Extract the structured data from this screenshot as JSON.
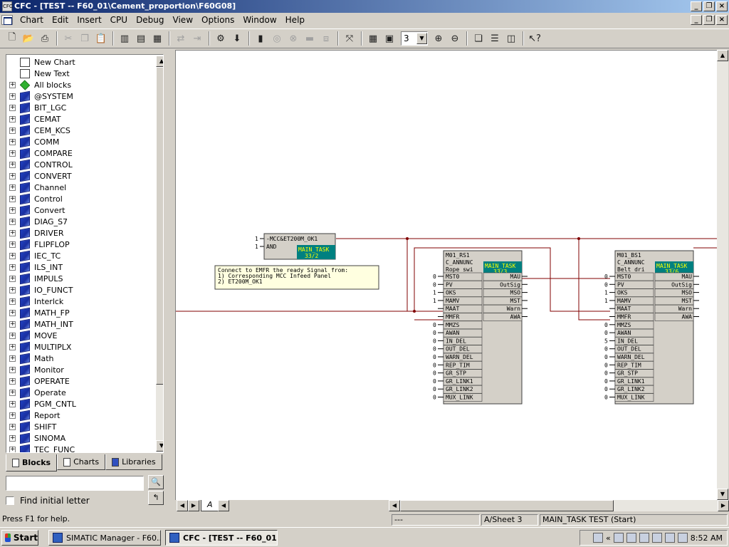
{
  "window": {
    "title": "CFC - [TEST -- F60_01\\Cement_proportion\\F60G08]",
    "app_icon": "cfc-app-icon"
  },
  "menu": [
    "Chart",
    "Edit",
    "Insert",
    "CPU",
    "Debug",
    "View",
    "Options",
    "Window",
    "Help"
  ],
  "toolbar": {
    "zoom_value": "3"
  },
  "tree": {
    "items": [
      {
        "label": "New Chart",
        "expandable": false,
        "icon": "new-chart-icon",
        "kind": "page"
      },
      {
        "label": "New Text",
        "expandable": false,
        "icon": "new-text-icon",
        "kind": "page"
      },
      {
        "label": "All blocks",
        "expandable": true,
        "icon": "all-blocks-icon",
        "kind": "gem"
      },
      {
        "label": "@SYSTEM",
        "expandable": true,
        "icon": "library-book-icon",
        "kind": "book"
      },
      {
        "label": "BIT_LGC",
        "expandable": true,
        "icon": "library-book-icon",
        "kind": "book"
      },
      {
        "label": "CEMAT",
        "expandable": true,
        "icon": "library-book-icon",
        "kind": "book"
      },
      {
        "label": "CEM_KCS",
        "expandable": true,
        "icon": "library-book-icon",
        "kind": "book"
      },
      {
        "label": "COMM",
        "expandable": true,
        "icon": "library-book-icon",
        "kind": "book"
      },
      {
        "label": "COMPARE",
        "expandable": true,
        "icon": "library-book-icon",
        "kind": "book"
      },
      {
        "label": "CONTROL",
        "expandable": true,
        "icon": "library-book-icon",
        "kind": "book"
      },
      {
        "label": "CONVERT",
        "expandable": true,
        "icon": "library-book-icon",
        "kind": "book"
      },
      {
        "label": "Channel",
        "expandable": true,
        "icon": "library-book-icon",
        "kind": "book"
      },
      {
        "label": "Control",
        "expandable": true,
        "icon": "library-book-icon",
        "kind": "book"
      },
      {
        "label": "Convert",
        "expandable": true,
        "icon": "library-book-icon",
        "kind": "book"
      },
      {
        "label": "DIAG_S7",
        "expandable": true,
        "icon": "library-book-icon",
        "kind": "book"
      },
      {
        "label": "DRIVER",
        "expandable": true,
        "icon": "library-book-icon",
        "kind": "book"
      },
      {
        "label": "FLIPFLOP",
        "expandable": true,
        "icon": "library-book-icon",
        "kind": "book"
      },
      {
        "label": "IEC_TC",
        "expandable": true,
        "icon": "library-book-icon",
        "kind": "book"
      },
      {
        "label": "ILS_INT",
        "expandable": true,
        "icon": "library-book-icon",
        "kind": "book"
      },
      {
        "label": "IMPULS",
        "expandable": true,
        "icon": "library-book-icon",
        "kind": "book"
      },
      {
        "label": "IO_FUNCT",
        "expandable": true,
        "icon": "library-book-icon",
        "kind": "book"
      },
      {
        "label": "Interlck",
        "expandable": true,
        "icon": "library-book-icon",
        "kind": "book"
      },
      {
        "label": "MATH_FP",
        "expandable": true,
        "icon": "library-book-icon",
        "kind": "book"
      },
      {
        "label": "MATH_INT",
        "expandable": true,
        "icon": "library-book-icon",
        "kind": "book"
      },
      {
        "label": "MOVE",
        "expandable": true,
        "icon": "library-book-icon",
        "kind": "book"
      },
      {
        "label": "MULTIPLX",
        "expandable": true,
        "icon": "library-book-icon",
        "kind": "book"
      },
      {
        "label": "Math",
        "expandable": true,
        "icon": "library-book-icon",
        "kind": "book"
      },
      {
        "label": "Monitor",
        "expandable": true,
        "icon": "library-book-icon",
        "kind": "book"
      },
      {
        "label": "OPERATE",
        "expandable": true,
        "icon": "library-book-icon",
        "kind": "book"
      },
      {
        "label": "Operate",
        "expandable": true,
        "icon": "library-book-icon",
        "kind": "book"
      },
      {
        "label": "PGM_CNTL",
        "expandable": true,
        "icon": "library-book-icon",
        "kind": "book"
      },
      {
        "label": "Report",
        "expandable": true,
        "icon": "library-book-icon",
        "kind": "book"
      },
      {
        "label": "SHIFT",
        "expandable": true,
        "icon": "library-book-icon",
        "kind": "book"
      },
      {
        "label": "SINOMA",
        "expandable": true,
        "icon": "library-book-icon",
        "kind": "book"
      },
      {
        "label": "TEC_FUNC",
        "expandable": true,
        "icon": "library-book-icon",
        "kind": "book"
      }
    ]
  },
  "panel_tabs": [
    {
      "label": "Blocks",
      "icon": "blocks-tab-icon",
      "active": true
    },
    {
      "label": "Charts",
      "icon": "charts-tab-icon",
      "active": false
    },
    {
      "label": "Libraries",
      "icon": "libraries-tab-icon",
      "active": false
    }
  ],
  "find": {
    "value": "",
    "checkbox_label": "Find initial letter"
  },
  "canvas": {
    "and_block": {
      "name": "-MCC&ET200M_OK1",
      "type": "AND",
      "task": "MAIN_TASK",
      "task_seq": "33/2",
      "inputs": [
        {
          "name": "",
          "val": "1"
        },
        {
          "name": "",
          "val": "1"
        }
      ]
    },
    "comment": [
      "Connect to EMFR the ready Signal from:",
      "1) Corresponding MCC Infeed Panel",
      "2) ET200M_OK1"
    ],
    "blocks": [
      {
        "name": "M01_RS1",
        "type": "C_ANNUNC",
        "desc": "Rope swi",
        "task": "MAIN_TASK",
        "task_seq": "33/3",
        "inputs": [
          {
            "n": "MST0",
            "v": "0"
          },
          {
            "n": "PV",
            "v": "0"
          },
          {
            "n": "OKS",
            "v": "1"
          },
          {
            "n": "MAMV",
            "v": "1"
          },
          {
            "n": "MAAT",
            "v": ""
          },
          {
            "n": "MMFR",
            "v": ""
          },
          {
            "n": "MMZS",
            "v": "0"
          },
          {
            "n": "AWAN",
            "v": "0"
          },
          {
            "n": "IN_DEL",
            "v": "0"
          },
          {
            "n": "OUT_DEL",
            "v": "0"
          },
          {
            "n": "WARN_DEL",
            "v": "0"
          },
          {
            "n": "REP_TIM",
            "v": "0"
          },
          {
            "n": "GR_STP",
            "v": "0"
          },
          {
            "n": "GR_LINK1",
            "v": "0"
          },
          {
            "n": "GR_LINK2",
            "v": "0"
          },
          {
            "n": "MUX_LINK",
            "v": "0"
          }
        ],
        "outputs": [
          "MAU",
          "OutSig",
          "MSO",
          "MST",
          "Warn",
          "AWA"
        ]
      },
      {
        "name": "M01_BS1",
        "type": "C_ANNUNC",
        "desc": "Belt dri",
        "task": "MAIN_TASK",
        "task_seq": "33/6",
        "inputs": [
          {
            "n": "MST0",
            "v": "0"
          },
          {
            "n": "PV",
            "v": "0"
          },
          {
            "n": "OKS",
            "v": "1"
          },
          {
            "n": "MAMV",
            "v": "1"
          },
          {
            "n": "MAAT",
            "v": ""
          },
          {
            "n": "MMFR",
            "v": ""
          },
          {
            "n": "MMZS",
            "v": "0"
          },
          {
            "n": "AWAN",
            "v": "0"
          },
          {
            "n": "IN_DEL",
            "v": "5"
          },
          {
            "n": "OUT_DEL",
            "v": "0"
          },
          {
            "n": "WARN_DEL",
            "v": "0"
          },
          {
            "n": "REP_TIM",
            "v": "0"
          },
          {
            "n": "GR_STP",
            "v": "0"
          },
          {
            "n": "GR_LINK1",
            "v": "0"
          },
          {
            "n": "GR_LINK2",
            "v": "0"
          },
          {
            "n": "MUX_LINK",
            "v": "0"
          }
        ],
        "outputs": [
          "MAU",
          "OutSig",
          "MSO",
          "MST",
          "Warn",
          "AWA"
        ]
      }
    ]
  },
  "sheet_tab": "A",
  "status": {
    "help": "Press F1 for help.",
    "mode": "---",
    "sheet": "A/Sheet 3",
    "task": "MAIN_TASK TEST (Start)"
  },
  "taskbar": {
    "start": "Start",
    "tasks": [
      {
        "label": "SIMATIC Manager - F60...",
        "active": false
      },
      {
        "label": "CFC - [TEST -- F60_01...",
        "active": true
      }
    ],
    "clock": "8:52 AM"
  },
  "colors": {
    "wire": "#800000",
    "task_bg": "#008080",
    "task_fg": "#ffff00",
    "block_bg": "#d4d0c8",
    "comment_bg": "#ffffe0"
  }
}
